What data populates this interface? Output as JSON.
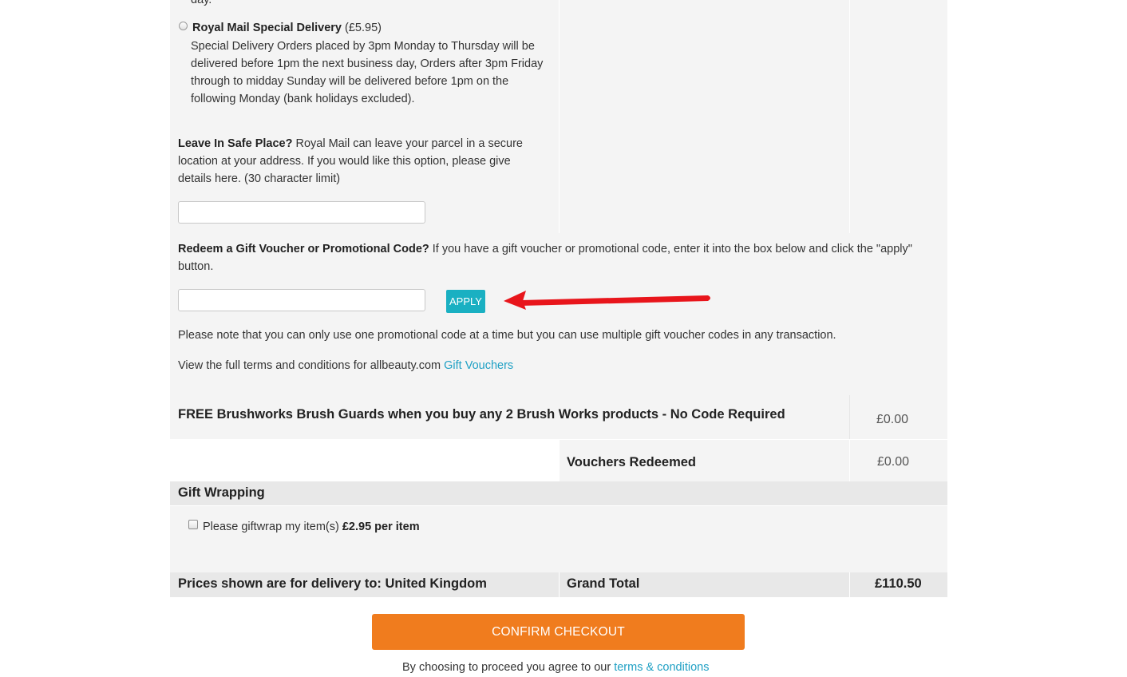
{
  "delivery": {
    "partial_top_text": "day.",
    "special": {
      "name": "Royal Mail Special Delivery",
      "price": "(£5.95)",
      "description": [
        "Special Delivery Orders placed by 3pm Monday to Thursday will be",
        "delivered before 1pm the next business day, Orders after 3pm Friday",
        "through to midday Sunday will be delivered before 1pm on the",
        "following Monday (bank holidays excluded)."
      ]
    },
    "safe_place": {
      "title": "Leave In Safe Place?",
      "text_lines": [
        " Royal Mail can leave your parcel in a secure",
        "location at your address. If you would like this option, please give",
        "details here. (30 character limit)"
      ],
      "value": ""
    }
  },
  "voucher": {
    "title": "Redeem a Gift Voucher or Promotional Code?",
    "text_line1": " If you have a gift voucher or promotional code, enter it into the box below and click the \"apply\"",
    "text_line2": "button.",
    "input_value": "",
    "apply_label": "APPLY",
    "arrow_color": "#e8151b",
    "note": "Please note that you can only use one promotional code at a time but you can use multiple gift voucher codes in any transaction.",
    "terms_prefix": "View the full terms and conditions for allbeauty.com ",
    "terms_link": "Gift Vouchers"
  },
  "promotion": {
    "label": "FREE Brushworks Brush Guards when you buy any 2 Brush Works products - No Code Required",
    "amount": "£0.00"
  },
  "vouchers_redeemed": {
    "label": "Vouchers Redeemed",
    "amount": "£0.00"
  },
  "gift_wrapping": {
    "heading": "Gift Wrapping",
    "checkbox_label": "Please giftwrap my item(s) ",
    "checkbox_price": "£2.95 per item"
  },
  "totals": {
    "delivery_note": "Prices shown are for delivery to: United Kingdom",
    "grand_total_label": "Grand Total",
    "grand_total_amount": "£110.50"
  },
  "checkout": {
    "confirm_label": "CONFIRM CHECKOUT",
    "agree_prefix": "By choosing to proceed you agree to our ",
    "agree_link": "terms & conditions"
  },
  "colors": {
    "accent_teal": "#1ab0c2",
    "confirm_orange": "#f07c1e",
    "link_blue": "#1fa0c4"
  }
}
